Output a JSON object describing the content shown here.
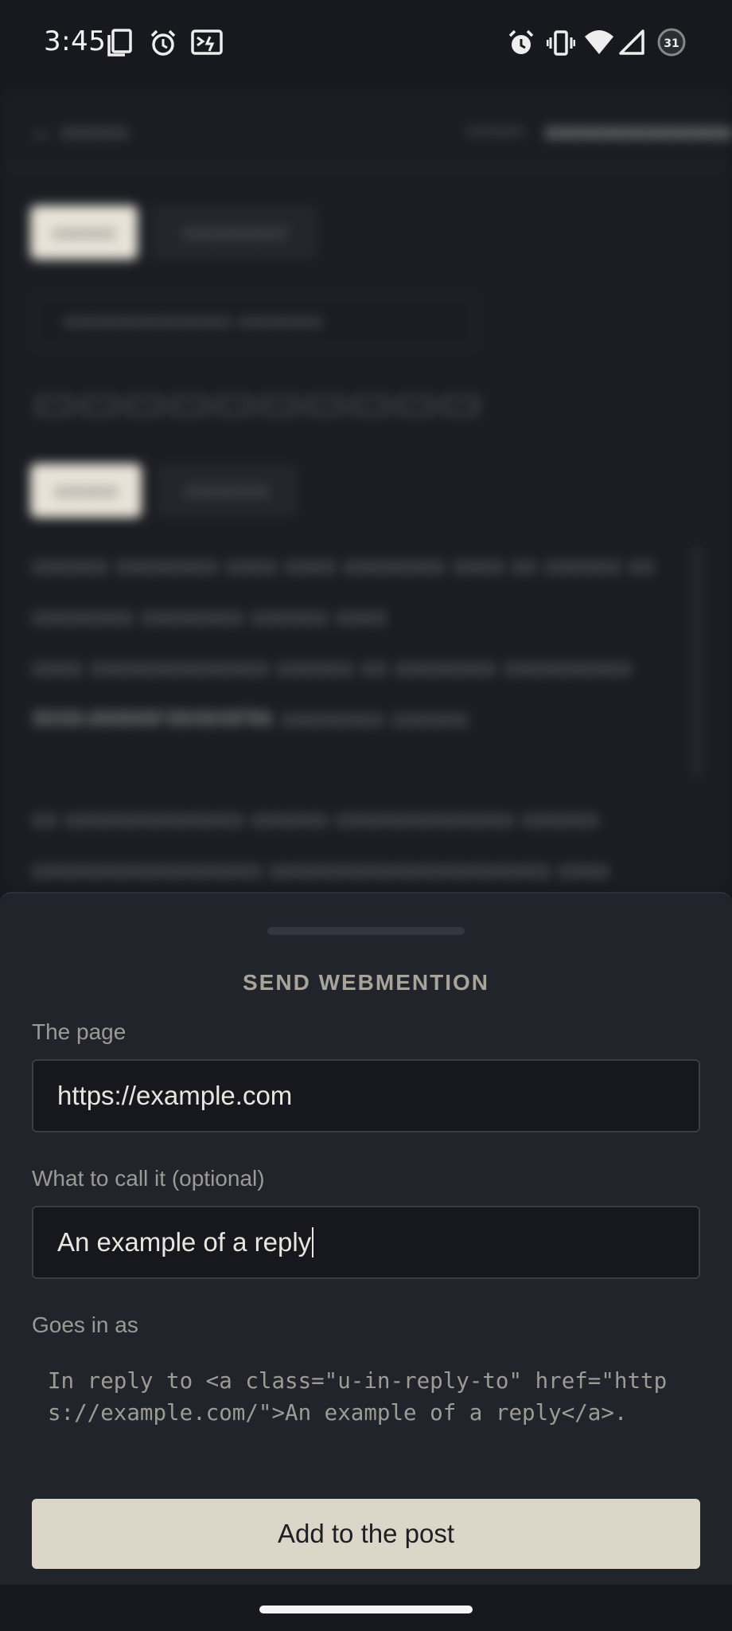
{
  "status_bar": {
    "time": "3:45",
    "left_icons": [
      "copy-icon",
      "alarm-icon",
      "cast-icon"
    ],
    "right_icons": [
      "alarm-icon",
      "vibrate-icon",
      "wifi-icon",
      "signal-icon",
      "battery-icon"
    ],
    "battery_label": "31"
  },
  "sheet": {
    "title": "SEND WEBMENTION",
    "page_label": "The page",
    "page_value": "https://example.com",
    "name_label": "What to call it (optional)",
    "name_value": "An example of a reply",
    "goes_in_label": "Goes in as",
    "preview_code": "In reply to <a class=\"u-in-reply-to\" href=\"https://example.com/\">An example of a reply</a>.",
    "add_button": "Add to the post"
  },
  "colors": {
    "sheet_bg": "#21242b",
    "button_bg": "#dcd6c8",
    "input_bg": "#17181d"
  }
}
